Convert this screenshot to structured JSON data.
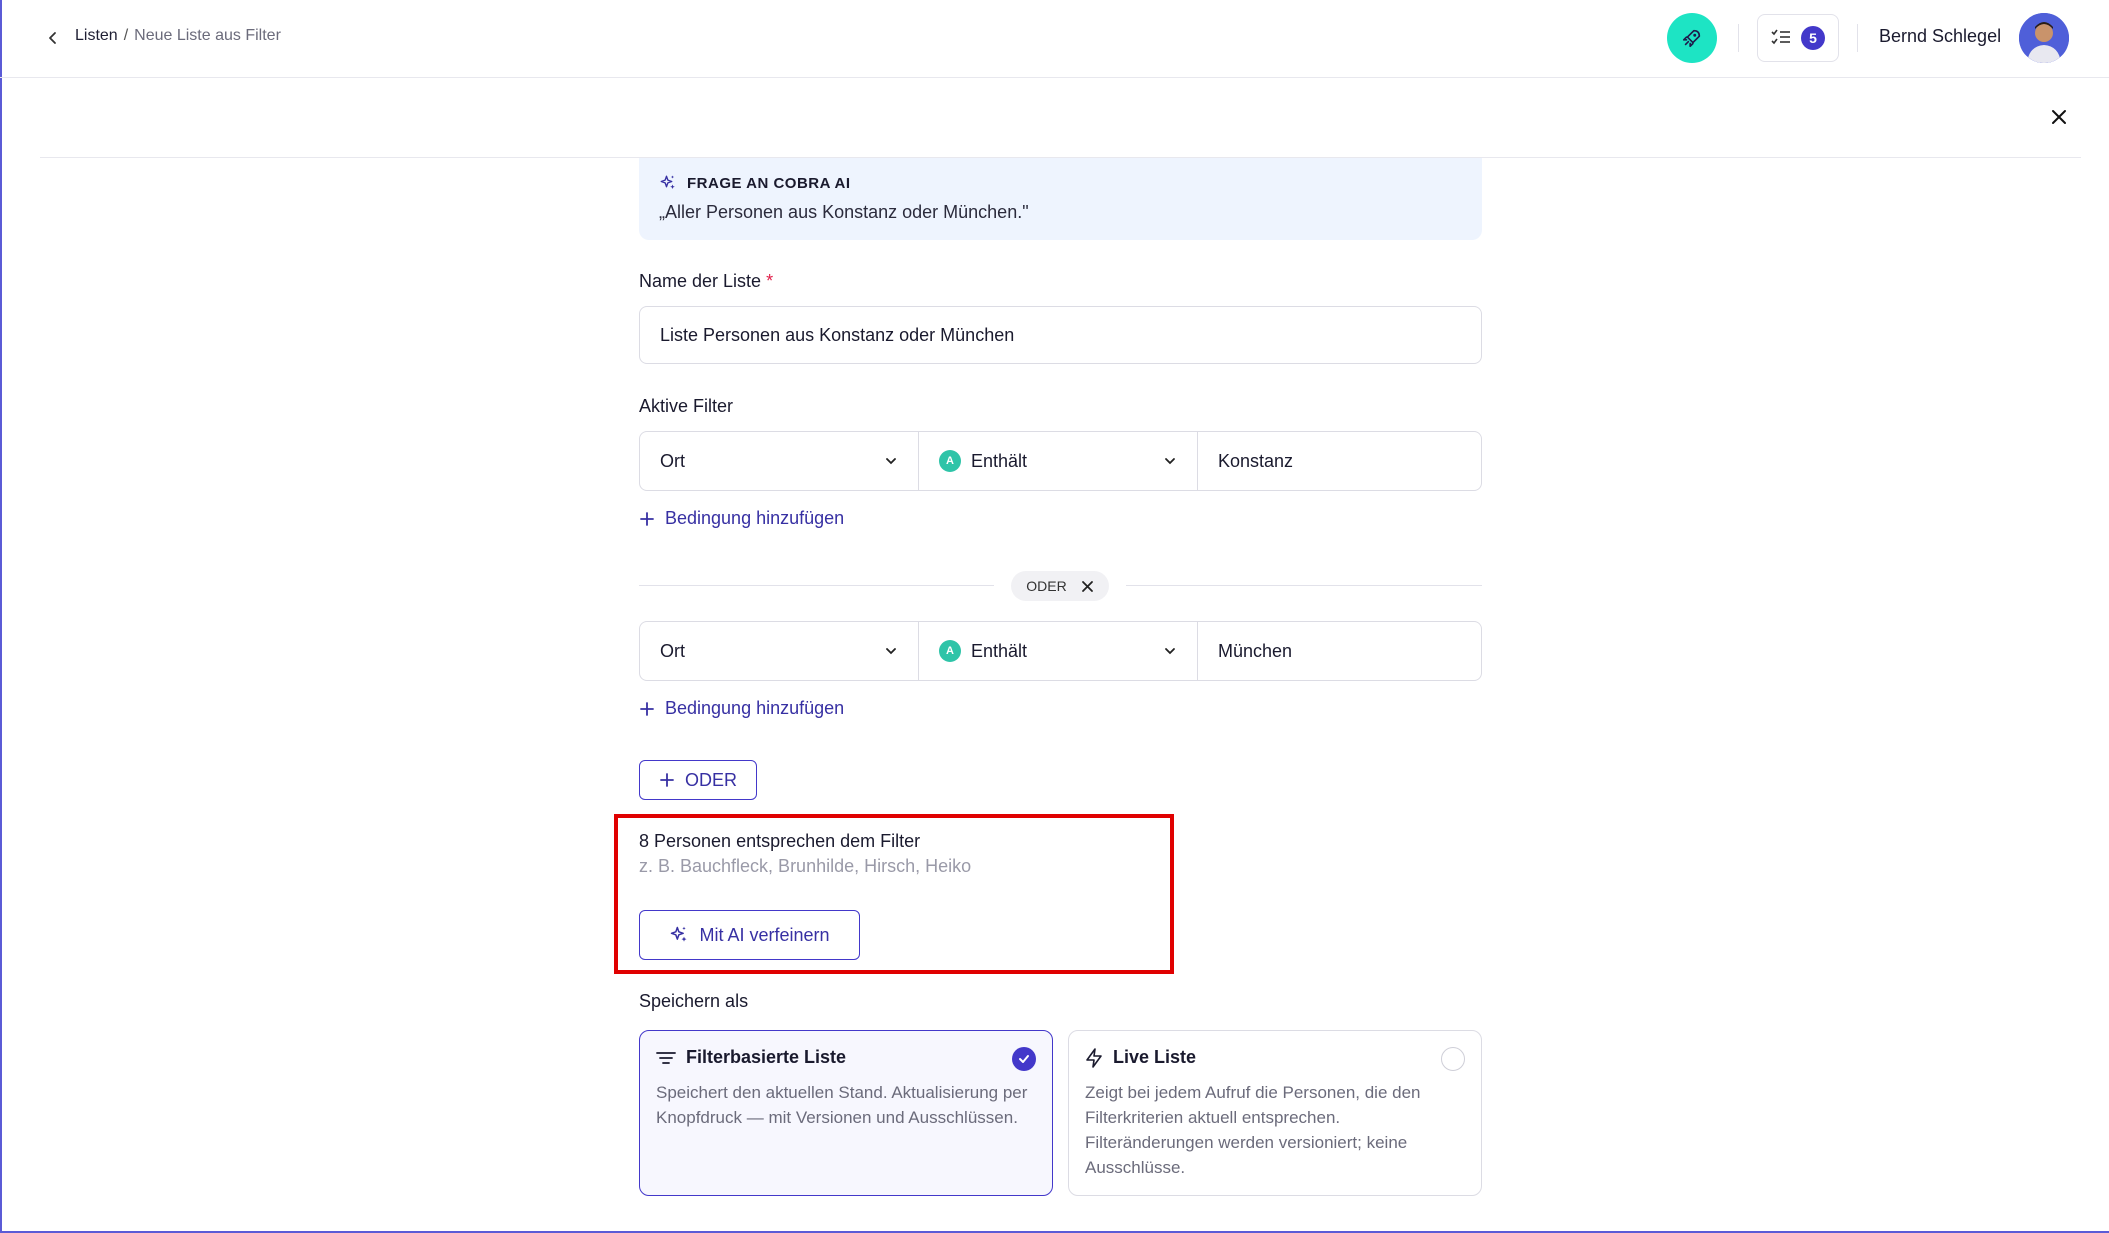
{
  "header": {
    "breadcrumb": {
      "parent": "Listen",
      "separator": "/",
      "current": "Neue Liste aus Filter"
    },
    "tasks_count": "5",
    "user_name": "Bernd Schlegel"
  },
  "ai_prompt": {
    "title": "FRAGE AN COBRA AI",
    "quote": "„Aller Personen aus Konstanz oder München.\""
  },
  "form": {
    "name_label": "Name der Liste",
    "required_mark": "*",
    "name_value": "Liste Personen aus Konstanz oder München",
    "filters_label": "Aktive Filter",
    "filter_groups": [
      {
        "field": "Ort",
        "operator": "Enthält",
        "value": "Konstanz",
        "add_condition": "Bedingung hinzufügen"
      },
      {
        "field": "Ort",
        "operator": "Enthält",
        "value": "München",
        "add_condition": "Bedingung hinzufügen"
      }
    ],
    "or_separator": "ODER",
    "add_or_button": "ODER"
  },
  "results": {
    "match_text": "8 Personen entsprechen dem Filter",
    "examples": "z. B. Bauchfleck, Brunhilde, Hirsch, Heiko",
    "refine_button": "Mit AI verfeinern"
  },
  "save_as": {
    "label": "Speichern als",
    "options": [
      {
        "title": "Filterbasierte Liste",
        "description": "Speichert den aktuellen Stand. Aktualisierung per Knopfdruck — mit Versionen und Ausschlüssen.",
        "selected": true
      },
      {
        "title": "Live Liste",
        "description": "Zeigt bei jedem Aufruf die Personen, die den Filterkriterien aktuell entsprechen. Filteränderungen werden versioniert; keine Ausschlüsse.",
        "selected": false
      }
    ]
  },
  "colors": {
    "accent": "#4338ca",
    "rocket": "#1de4c4",
    "ai_box": "#eef4fe",
    "highlight": "#e00000"
  },
  "icons": [
    "chevron-left-icon",
    "rocket-icon",
    "checklist-icon",
    "close-icon",
    "sparkles-icon",
    "chevron-down-icon",
    "ai-operator-icon",
    "plus-icon",
    "filter-lines-icon",
    "bolt-icon",
    "check-icon"
  ]
}
